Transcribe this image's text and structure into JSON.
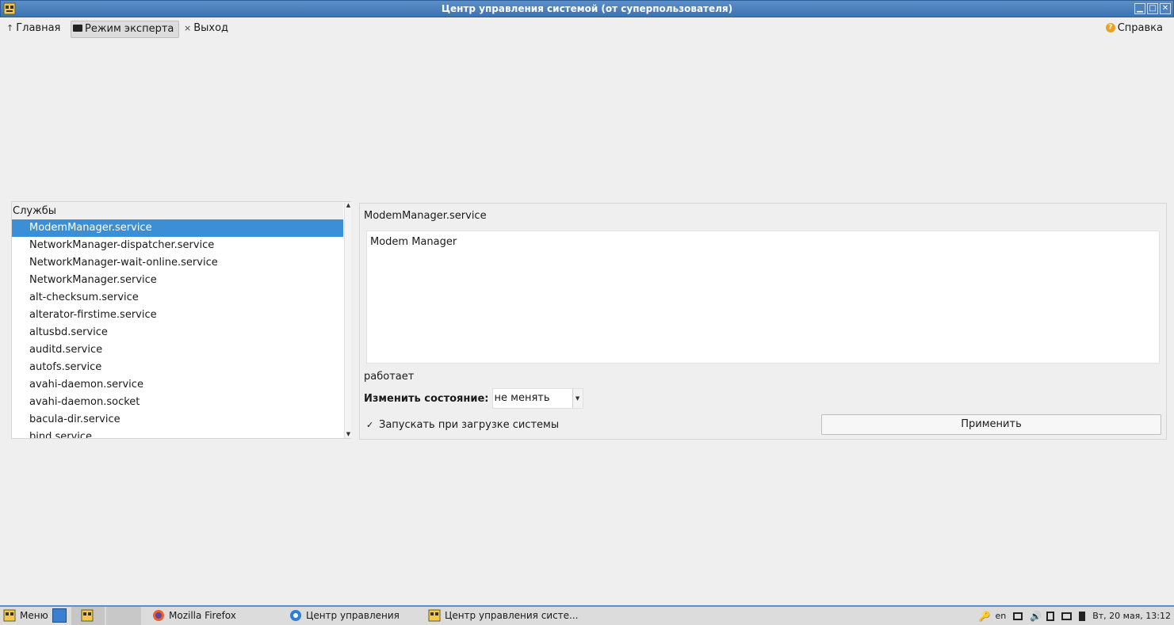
{
  "window": {
    "title": "Центр управления системой (от суперпользователя)",
    "minimize_icon": "minimize-icon",
    "maximize_icon": "maximize-icon",
    "close_icon": "close-icon"
  },
  "toolbar": {
    "home_arrow": "↑",
    "home_label": "Главная",
    "expert_label": "Режим эксперта",
    "exit_x": "×",
    "exit_label": "Выход",
    "help_mark": "?",
    "help_label": "Справка"
  },
  "services": {
    "header": "Службы",
    "items": [
      "ModemManager.service",
      "NetworkManager-dispatcher.service",
      "NetworkManager-wait-online.service",
      "NetworkManager.service",
      "alt-checksum.service",
      "alterator-firstime.service",
      "altusbd.service",
      "auditd.service",
      "autofs.service",
      "avahi-daemon.service",
      "avahi-daemon.socket",
      "bacula-dir.service",
      "bind.service"
    ],
    "selected_index": 0
  },
  "detail": {
    "service_name": "ModemManager.service",
    "description": "Modem Manager",
    "status": "работает",
    "change_state_label": "Изменить состояние:",
    "change_state_value": "не менять",
    "autostart_label": "Запускать при загрузке системы",
    "autostart_checked": true,
    "apply_label": "Применить"
  },
  "taskbar": {
    "menu_label": "Меню",
    "tasks": [
      {
        "label": "Mozilla Firefox",
        "icon": "firefox-icon"
      },
      {
        "label": "Центр управления",
        "icon": "control-center-icon"
      },
      {
        "label": "Центр управления систе...",
        "icon": "alterator-icon"
      }
    ],
    "keyboard_layout": "en",
    "datetime": "Вт, 20 мая, 13:12"
  },
  "colors": {
    "titlebar": "#4a80bf",
    "selection": "#3b8fd6",
    "background": "#efefef"
  }
}
